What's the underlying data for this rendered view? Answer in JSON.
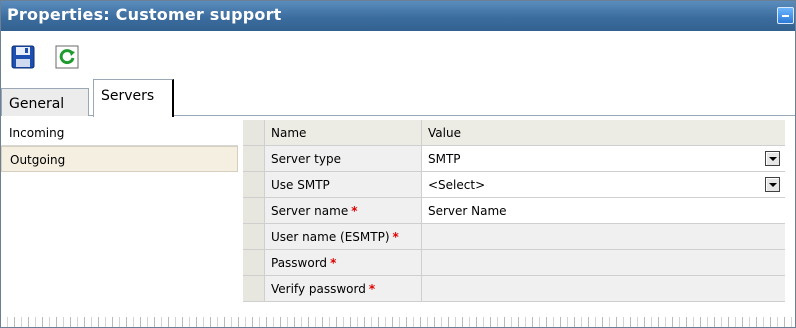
{
  "window": {
    "title": "Properties: Customer support"
  },
  "toolbar": {
    "save_icon": "save-icon",
    "refresh_icon": "refresh-icon"
  },
  "tabs": [
    {
      "label": "General",
      "active": false
    },
    {
      "label": "Servers",
      "active": true
    }
  ],
  "server_list": [
    {
      "label": "Incoming",
      "selected": false
    },
    {
      "label": "Outgoing",
      "selected": true
    }
  ],
  "grid": {
    "headers": {
      "name": "Name",
      "value": "Value"
    },
    "rows": [
      {
        "name": "Server type",
        "value": "SMTP",
        "required": false,
        "dropdown": true
      },
      {
        "name": "Use SMTP",
        "value": "<Select>",
        "required": false,
        "dropdown": true
      },
      {
        "name": "Server name",
        "value": "Server Name",
        "required": true,
        "dropdown": false
      },
      {
        "name": "User name (ESMTP)",
        "value": "",
        "required": true,
        "dropdown": false
      },
      {
        "name": "Password",
        "value": "",
        "required": true,
        "dropdown": false
      },
      {
        "name": "Verify password",
        "value": "",
        "required": true,
        "dropdown": false
      }
    ],
    "required_marker": "*"
  },
  "colors": {
    "titlebar": "#3c6d9f",
    "selected_item": "#f4efe1",
    "required": "#e00000"
  }
}
